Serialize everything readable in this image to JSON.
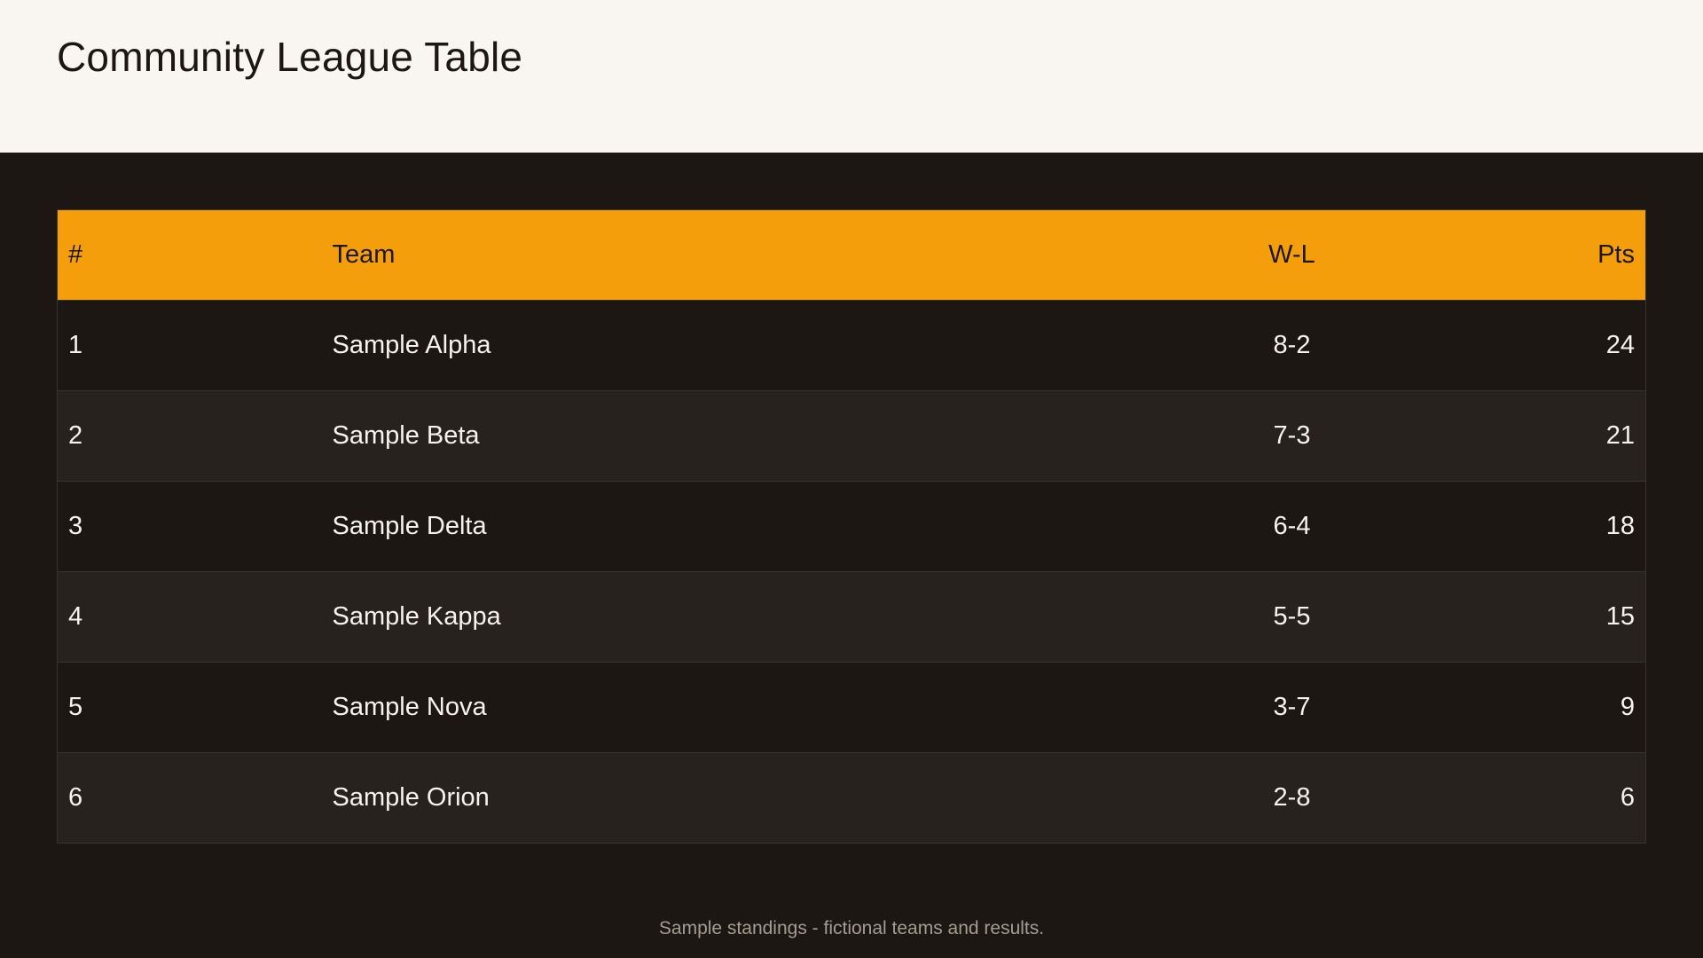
{
  "page": {
    "title": "Community League Table",
    "footnote": "Sample standings - fictional teams and results."
  },
  "table": {
    "headers": {
      "rank": "#",
      "team": "Team",
      "wl": "W-L",
      "pts": "Pts"
    },
    "rows": [
      {
        "rank": "1",
        "team": "Sample Alpha",
        "wl": "8-2",
        "pts": "24"
      },
      {
        "rank": "2",
        "team": "Sample Beta",
        "wl": "7-3",
        "pts": "21"
      },
      {
        "rank": "3",
        "team": "Sample Delta",
        "wl": "6-4",
        "pts": "18"
      },
      {
        "rank": "4",
        "team": "Sample Kappa",
        "wl": "5-5",
        "pts": "15"
      },
      {
        "rank": "5",
        "team": "Sample Nova",
        "wl": "3-7",
        "pts": "9"
      },
      {
        "rank": "6",
        "team": "Sample Orion",
        "wl": "2-8",
        "pts": "6"
      }
    ]
  },
  "colors": {
    "header_bg": "#f9f6f1",
    "accent": "#f59e0b",
    "page_bg": "#1c1713",
    "row_alt_bg": "#28221e",
    "text_light": "#f6f2ec",
    "text_muted": "#a59d94"
  }
}
